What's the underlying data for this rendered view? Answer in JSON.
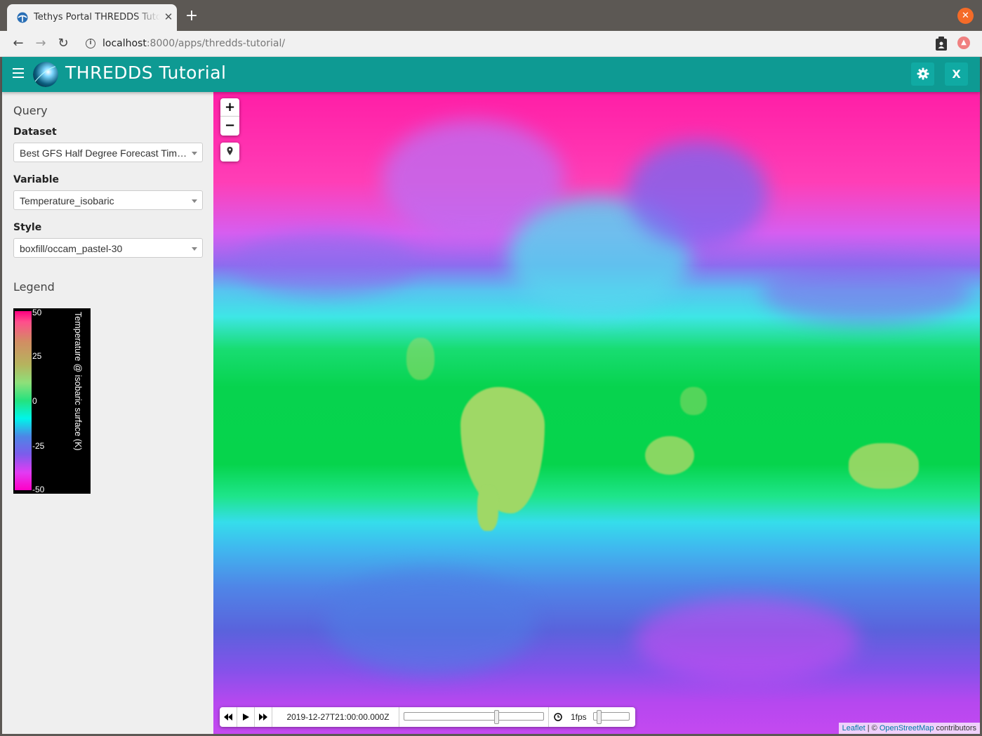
{
  "browser": {
    "tab_title": "Tethys Portal THREDDS Tutorial",
    "tab_close": "✕",
    "new_tab": "+",
    "url_host": "localhost",
    "url_rest": ":8000/apps/thredds-tutorial/"
  },
  "header": {
    "title": "THREDDS Tutorial",
    "exit_label": "X"
  },
  "sidebar": {
    "query_title": "Query",
    "dataset_label": "Dataset",
    "dataset_value": "Best GFS Half Degree Forecast Time Series",
    "variable_label": "Variable",
    "variable_value": "Temperature_isobaric",
    "style_label": "Style",
    "style_value": "boxfill/occam_pastel-30",
    "legend_title": "Legend",
    "legend": {
      "ticks": [
        "50",
        "25",
        "0",
        "-25",
        "-50"
      ],
      "caption": "Temperature @ isobaric surface (K)"
    }
  },
  "map": {
    "zoom_in": "+",
    "zoom_out": "−",
    "timebar": {
      "time": "2019-12-27T21:00:00.000Z",
      "fps": "1fps",
      "time_position": 0.67,
      "fps_position": 0.1
    },
    "attribution": {
      "leaflet": "Leaflet",
      "sep": " | © ",
      "osm": "OpenStreetMap",
      "suffix": " contributors"
    }
  }
}
